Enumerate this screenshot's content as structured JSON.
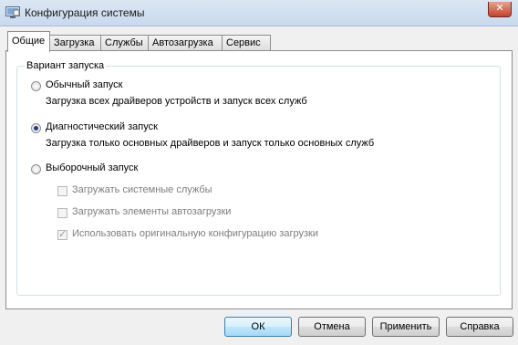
{
  "window": {
    "title": "Конфигурация системы"
  },
  "tabs": [
    {
      "label": "Общие",
      "active": true
    },
    {
      "label": "Загрузка",
      "active": false
    },
    {
      "label": "Службы",
      "active": false
    },
    {
      "label": "Автозагрузка",
      "active": false
    },
    {
      "label": "Сервис",
      "active": false
    }
  ],
  "startup": {
    "group_label": "Вариант запуска",
    "options": [
      {
        "label": "Обычный запуск",
        "description": "Загрузка всех драйверов устройств и запуск всех служб",
        "selected": false
      },
      {
        "label": "Диагностический запуск",
        "description": "Загрузка только основных драйверов и запуск только основных служб",
        "selected": true
      },
      {
        "label": "Выборочный запуск",
        "selected": false
      }
    ],
    "selective_checks": [
      {
        "label": "Загружать системные службы",
        "checked": false
      },
      {
        "label": "Загружать элементы автозагрузки",
        "checked": false
      },
      {
        "label": "Использовать оригинальную конфигурацию загрузки",
        "checked": true
      }
    ]
  },
  "buttons": {
    "ok": "ОК",
    "cancel": "Отмена",
    "apply": "Применить",
    "help": "Справка"
  },
  "icons": {
    "app": "system-config-icon",
    "close": "close-icon"
  }
}
